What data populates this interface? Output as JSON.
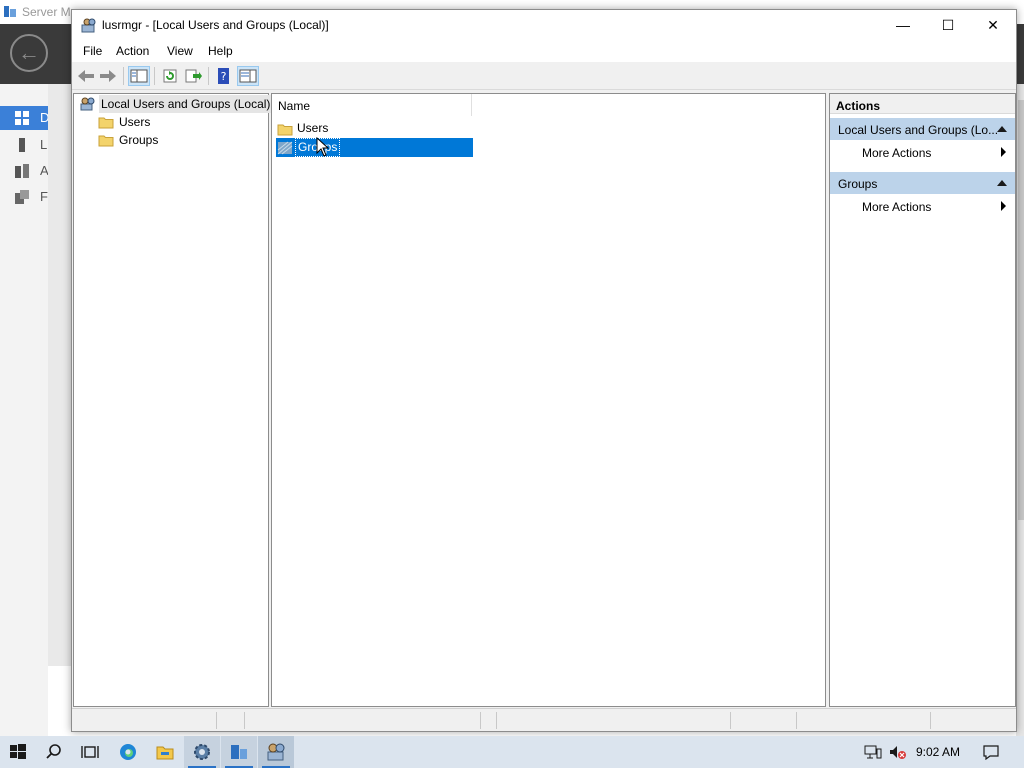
{
  "background": {
    "title": "Server Ma",
    "nav_letters": [
      "D",
      "L",
      "A",
      "F"
    ]
  },
  "window": {
    "title": "lusrmgr - [Local Users and Groups (Local)]",
    "minimize_glyph": "—",
    "maximize_glyph": "☐",
    "close_glyph": "✕"
  },
  "menu": {
    "items": [
      "File",
      "Action",
      "View",
      "Help"
    ]
  },
  "toolbar": {
    "icons": [
      "back-icon",
      "forward-icon",
      "show-hide-tree-icon",
      "refresh-icon",
      "export-list-icon",
      "help-icon",
      "show-hide-action-pane-icon"
    ]
  },
  "tree": {
    "root": "Local Users and Groups (Local)",
    "children": [
      "Users",
      "Groups"
    ]
  },
  "list": {
    "column": "Name",
    "rows": [
      "Users",
      "Groups"
    ],
    "selected_index": 1
  },
  "actions_pane": {
    "header": "Actions",
    "groups": [
      {
        "label": "Local Users and Groups (Lo...",
        "item": "More Actions"
      },
      {
        "label": "Groups",
        "item": "More Actions"
      }
    ]
  },
  "taskbar": {
    "time": "9:02 AM"
  },
  "colors": {
    "selection": "#0078d7",
    "action_group_bg": "#bcd3ea",
    "taskbar_bg": "#dbe4ee"
  }
}
